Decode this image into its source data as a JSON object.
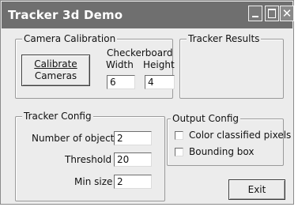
{
  "window": {
    "title": "Tracker 3d Demo"
  },
  "camera_calibration": {
    "legend": "Camera Calibration",
    "button_line1": "Calibrate",
    "button_line2": "Cameras",
    "checkerboard_label": "Checkerboard",
    "width_label": "Width",
    "height_label": "Height",
    "width_value": "6",
    "height_value": "4"
  },
  "tracker_results": {
    "legend": "Tracker Results"
  },
  "tracker_config": {
    "legend": "Tracker Config",
    "num_objects_label": "Number of objects",
    "num_objects_value": "2",
    "threshold_label": "Threshold",
    "threshold_value": "20",
    "min_size_label": "Min size",
    "min_size_value": "2"
  },
  "output_config": {
    "legend": "Output Config",
    "color_classified_label": "Color classified pixels",
    "color_classified_checked": false,
    "bounding_box_label": "Bounding box",
    "bounding_box_checked": false
  },
  "exit_button": {
    "label": "Exit"
  }
}
